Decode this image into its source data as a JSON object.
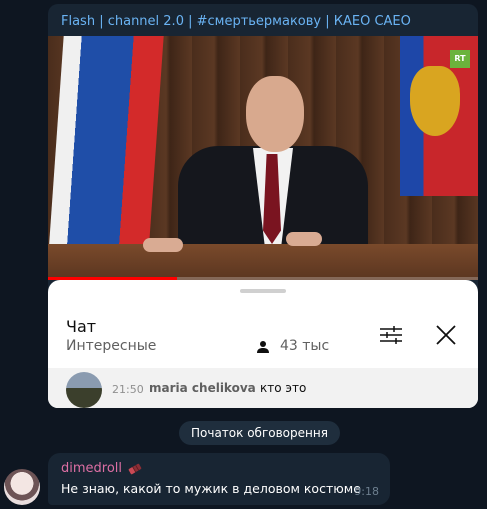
{
  "post": {
    "header": "Flash | channel 2.0 | #смертьермакову | КАЕО САЕО",
    "video": {
      "watermark": "RT",
      "progress": 0.3
    },
    "chat_card": {
      "title": "Чат",
      "subtitle": "Интересные",
      "viewers": "43 тыс",
      "message": {
        "time": "21:50",
        "author": "maria chelikova",
        "text": "кто это"
      }
    }
  },
  "discussion_button": "Початок обговорення",
  "reply": {
    "author": "dimedroll",
    "author_color": "#dd6fa4",
    "text": "Не знаю, какой то мужик в деловом костюме",
    "time": "9:18"
  },
  "colors": {
    "background": "#0e1621",
    "bubble": "#182533",
    "link": "#6ab3f3"
  }
}
